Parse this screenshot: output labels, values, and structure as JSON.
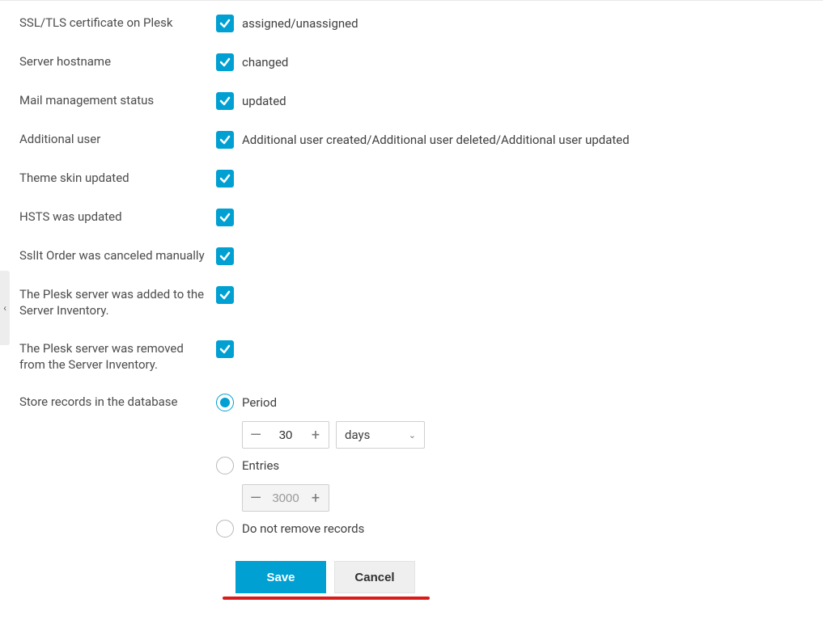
{
  "rows": [
    {
      "label": "SSL/TLS certificate on Plesk",
      "desc": "assigned/unassigned"
    },
    {
      "label": "Server hostname",
      "desc": "changed"
    },
    {
      "label": "Mail management status",
      "desc": "updated"
    },
    {
      "label": "Additional user",
      "desc": "Additional user created/Additional user deleted/Additional user updated"
    },
    {
      "label": "Theme skin updated",
      "desc": ""
    },
    {
      "label": "HSTS was updated",
      "desc": ""
    },
    {
      "label": "SslIt Order was canceled manually",
      "desc": ""
    },
    {
      "label": "The Plesk server was added to the Server Inventory.",
      "desc": ""
    },
    {
      "label": "The Plesk server was removed from the Server Inventory.",
      "desc": ""
    }
  ],
  "store": {
    "label": "Store records in the database",
    "period_label": "Period",
    "period_value": "30",
    "period_unit": "days",
    "entries_label": "Entries",
    "entries_value": "3000",
    "noremove_label": "Do not remove records"
  },
  "buttons": {
    "save": "Save",
    "cancel": "Cancel"
  },
  "collapse_glyph": "‹"
}
